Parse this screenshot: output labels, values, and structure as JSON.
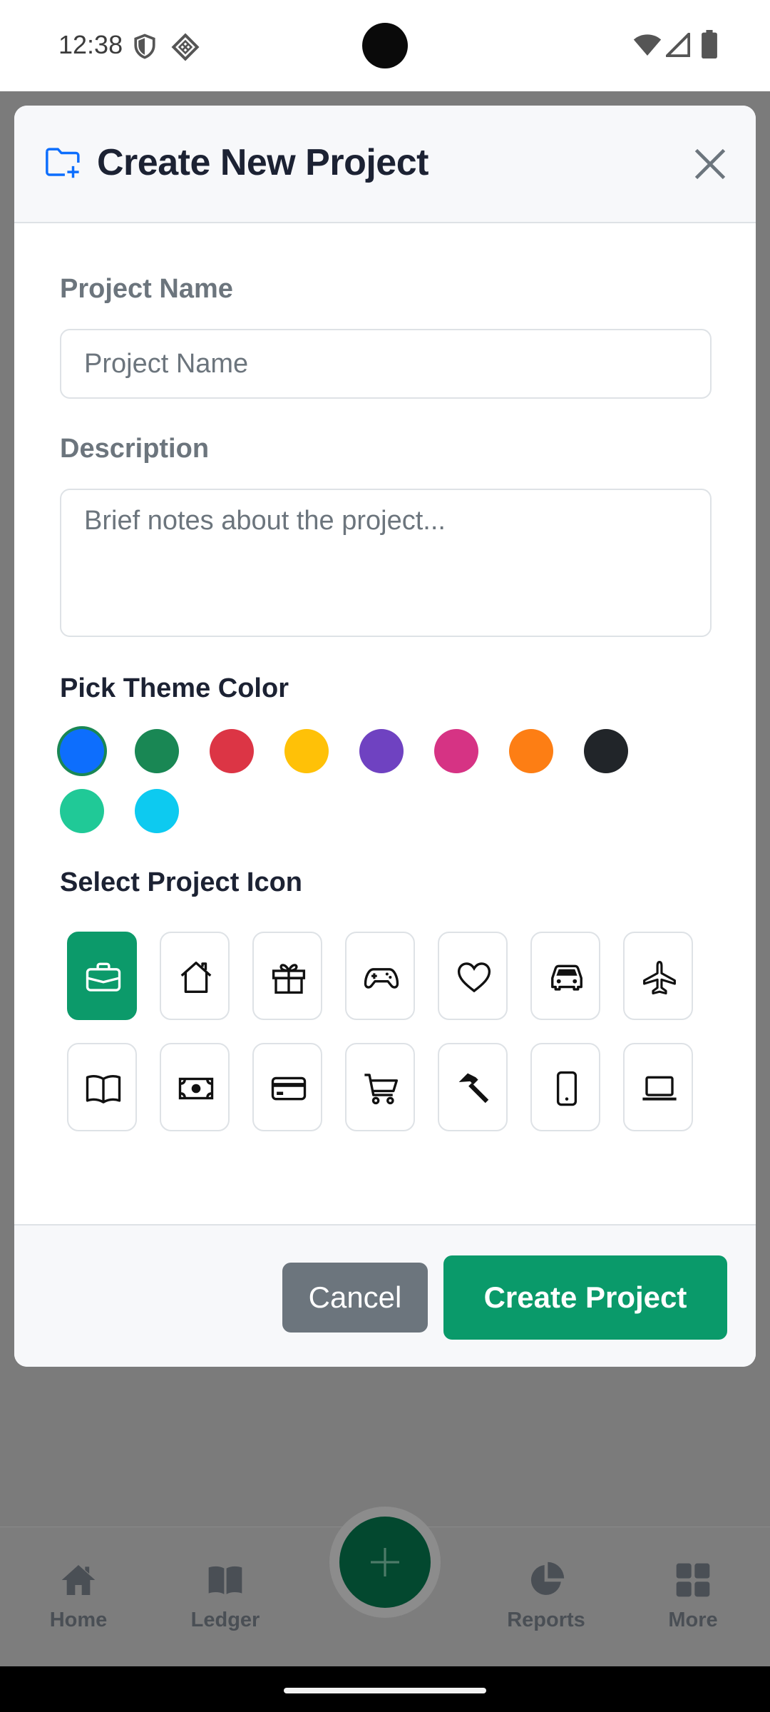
{
  "status_bar": {
    "time": "12:38",
    "icons": [
      "shield-icon",
      "diamond-grid-icon",
      "camera-cutout",
      "wifi-icon",
      "cell-signal-icon",
      "battery-icon"
    ]
  },
  "background_nav": {
    "items": [
      {
        "label": "Home",
        "icon": "home-icon"
      },
      {
        "label": "Ledger",
        "icon": "book-icon"
      },
      {
        "label": "Reports",
        "icon": "pie-chart-icon"
      },
      {
        "label": "More",
        "icon": "grid-icon"
      }
    ],
    "fab_icon": "plus-icon"
  },
  "modal": {
    "header_icon": "folder-plus-icon",
    "title": "Create New Project",
    "close_icon": "close-icon",
    "project_name": {
      "label": "Project Name",
      "placeholder": "Project Name",
      "value": ""
    },
    "description": {
      "label": "Description",
      "placeholder": "Brief notes about the project...",
      "value": ""
    },
    "theme_color": {
      "label": "Pick Theme Color",
      "selected": 0,
      "colors": [
        "#0d6efd",
        "#198754",
        "#dc3545",
        "#ffc107",
        "#6f42c1",
        "#d63384",
        "#fd7e14",
        "#212529",
        "#20c997",
        "#0dcaf0"
      ]
    },
    "project_icon": {
      "label": "Select Project Icon",
      "selected": 0,
      "icons": [
        "briefcase-icon",
        "house-icon",
        "gift-icon",
        "gamepad-icon",
        "heart-icon",
        "car-icon",
        "airplane-icon",
        "book-open-icon",
        "cash-icon",
        "credit-card-icon",
        "cart-icon",
        "hammer-icon",
        "phone-icon",
        "laptop-icon"
      ]
    },
    "footer": {
      "cancel_label": "Cancel",
      "create_label": "Create Project"
    },
    "accent_color": "#0a9a6a",
    "accent_header_icon_color": "#0d6efd"
  }
}
